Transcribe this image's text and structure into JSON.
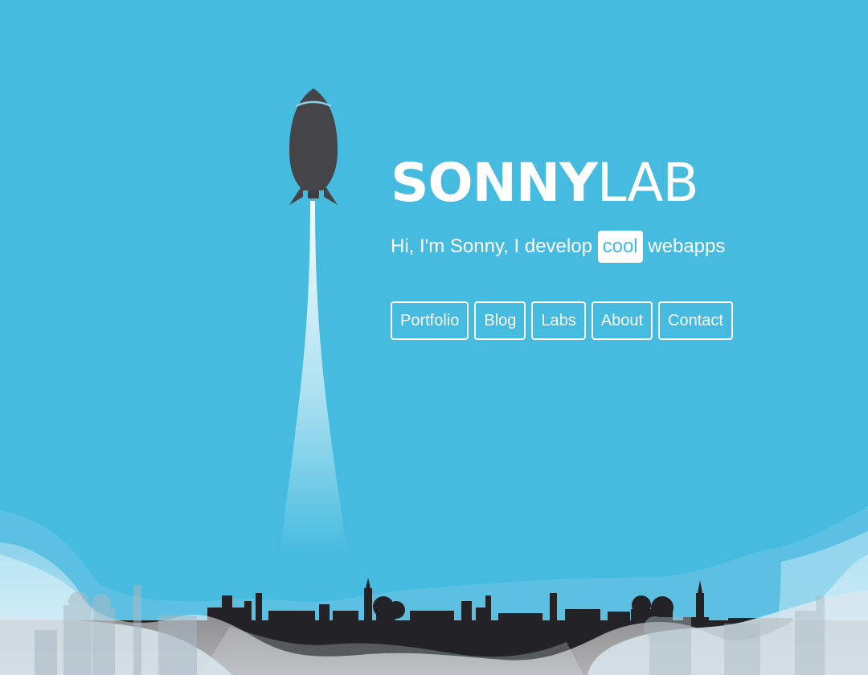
{
  "brand": {
    "strong": "SONNY",
    "light": "LAB"
  },
  "tagline": {
    "prefix": "Hi, I'm Sonny, I develop",
    "highlight": "cool",
    "suffix": "webapps"
  },
  "navigation": [
    "Portfolio",
    "Blog",
    "Labs",
    "About",
    "Contact"
  ],
  "colors": {
    "background": "#45bbdf",
    "white": "#ffffff",
    "rocket": "#454447",
    "skyline": "#232327",
    "cloud": "#d9e7ee"
  },
  "scene": {
    "rocket": "rocket-icon",
    "smoke_trail": "smoke-trail",
    "skyline": "city-skyline",
    "clouds": "cloud-layer"
  }
}
